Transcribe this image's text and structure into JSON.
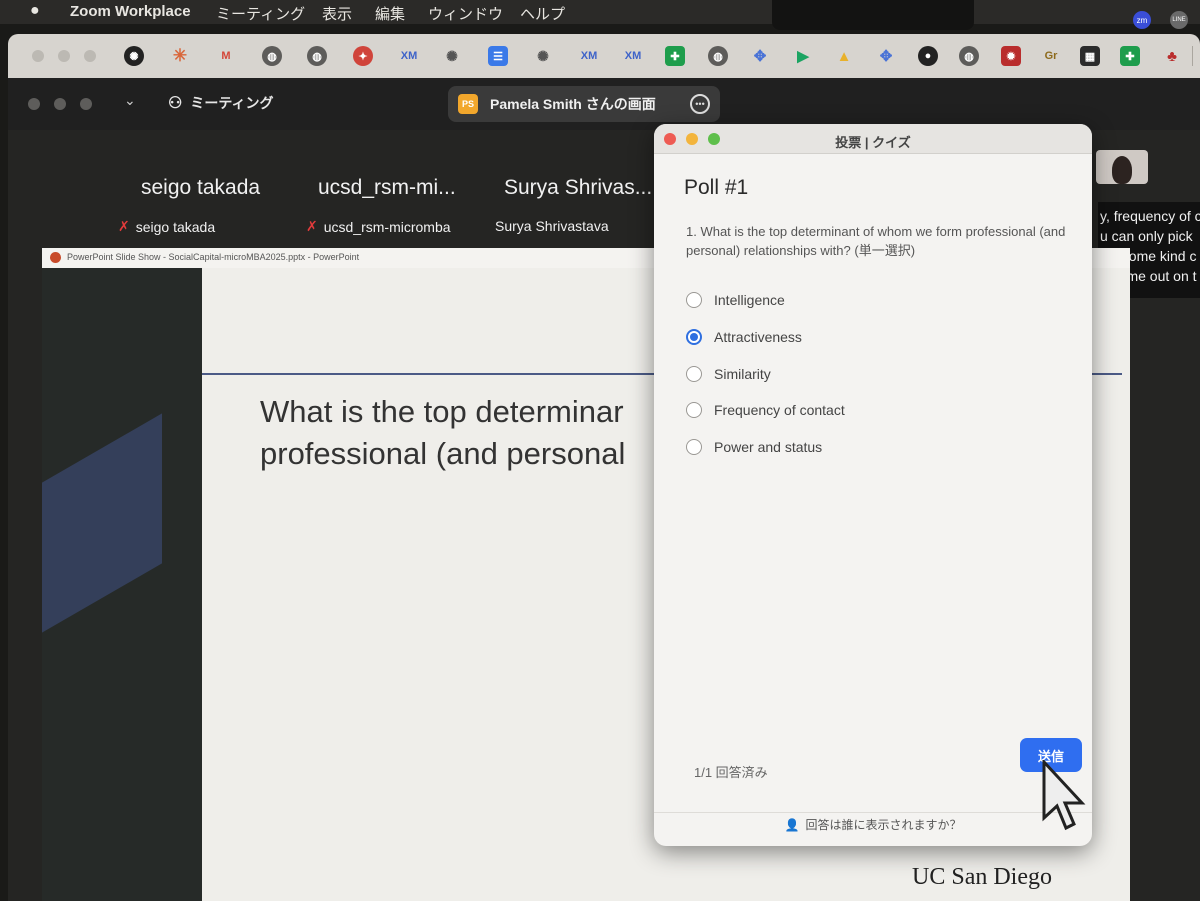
{
  "menubar": {
    "app_name": "Zoom Workplace",
    "items": [
      "ミーティング",
      "表示",
      "編集",
      "ウィンドウ",
      "ヘルプ"
    ],
    "tray_icons": [
      "zoom-tray-icon",
      "line-tray-icon"
    ],
    "tray_zoom": "zm",
    "tray_line": "LINE"
  },
  "bookmarks": {
    "icons": [
      "openai-icon",
      "claude-icon",
      "gmail-icon",
      "globe-icon",
      "globe-icon",
      "chrome-red-icon",
      "xm-icon",
      "sparkle-icon",
      "docs-icon",
      "sparkle-icon",
      "xm-icon",
      "xm-icon",
      "sheets-icon",
      "globe-icon",
      "gemini-icon",
      "play-icon",
      "drive-icon",
      "gemini-icon",
      "github-icon",
      "globe-icon",
      "gear-red-icon",
      "gr-icon",
      "notion-icon",
      "sheets-icon",
      "tree-icon"
    ],
    "labels": {
      "gmail": "M",
      "xm": "XM",
      "gr": "Gr"
    }
  },
  "zoom": {
    "meeting_label": "ミーティング",
    "share_badge": "PS",
    "share_label": "Pamela Smith さんの画面",
    "participants": [
      {
        "display": "seigo takada",
        "tag": "seigo takada",
        "muted": true
      },
      {
        "display": "ucsd_rsm-mi...",
        "tag": "ucsd_rsm-micromba",
        "muted": true
      },
      {
        "display": "Surya Shrivas...",
        "tag": "Surya Shrivastava",
        "muted": false
      }
    ],
    "captions": [
      "y, frequency of c",
      "u can only pick",
      "lay some kind c",
      "o come out on t"
    ]
  },
  "ppt": {
    "window_title": "PowerPoint Slide Show - SocialCapital-microMBA2025.pptx - PowerPoint",
    "question_line1": "What is the top determinar",
    "question_line2": "professional (and personal",
    "footer": "UC San Diego"
  },
  "poll": {
    "window_title": "投票 | クイズ",
    "heading": "Poll #1",
    "question": "1. What is the top determinant of whom we form professional (and personal) relationships with? (単一選択)",
    "options": [
      "Intelligence",
      "Attractiveness",
      "Similarity",
      "Frequency of contact",
      "Power and status"
    ],
    "selected_index": 1,
    "status": "1/1 回答済み",
    "submit_label": "送信",
    "footer_note": "回答は誰に表示されますか？"
  },
  "colors": {
    "accent": "#2f6ef0",
    "poll_bg": "#f4f3f1",
    "menubar_bg": "#2b2a28"
  }
}
